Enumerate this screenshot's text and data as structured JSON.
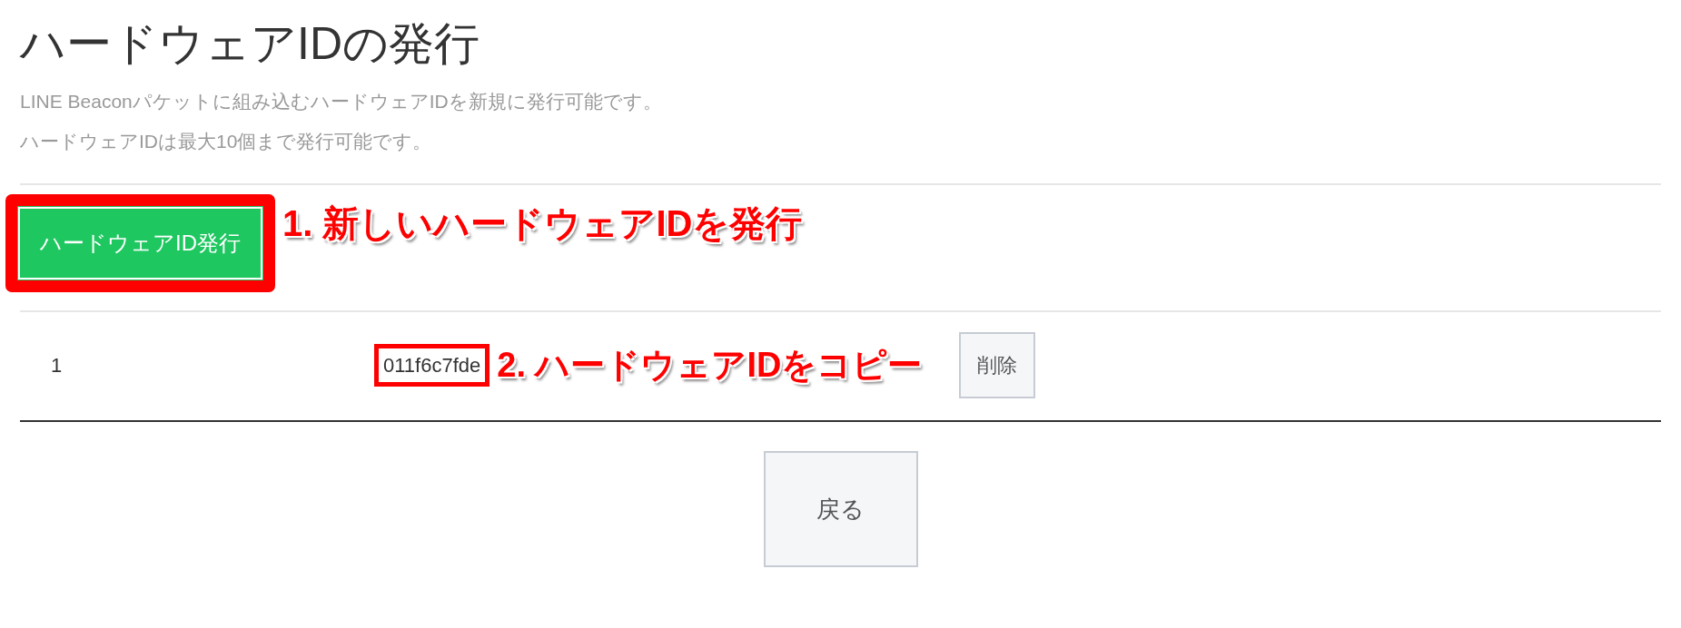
{
  "page": {
    "title": "ハードウェアIDの発行",
    "description": [
      "LINE Beaconパケットに組み込むハードウェアIDを新規に発行可能です。",
      "ハードウェアIDは最大10個まで発行可能です。"
    ]
  },
  "issue_button": {
    "label": "ハードウェアID発行",
    "highlighted": true
  },
  "issue_annotation": "1. 新しいハードウェアIDを発行",
  "table": {
    "rows": [
      {
        "number": "1",
        "hardware_id": "011f6c7fde",
        "highlighted": true,
        "annotation": "2. ハードウェアIDをコピー",
        "delete_button": "削除"
      }
    ]
  },
  "back_button": "戻る"
}
